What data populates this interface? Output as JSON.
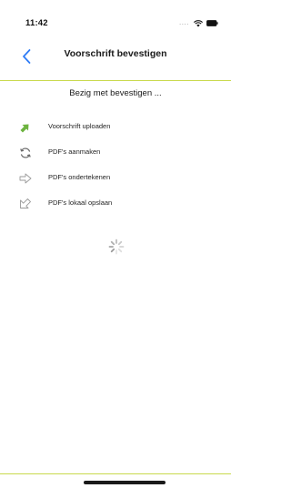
{
  "status_bar": {
    "time": "11:42",
    "signal": "....",
    "wifi_icon": "wifi-icon",
    "battery_icon": "battery-icon"
  },
  "nav": {
    "back_icon": "chevron-left-icon",
    "title": "Voorschrift bevestigen"
  },
  "status_message": "Bezig met bevestigen ...",
  "steps": [
    {
      "label": "Voorschrift uploaden",
      "icon": "arrow-up-right-icon",
      "state": "done"
    },
    {
      "label": "PDF's aanmaken",
      "icon": "refresh-icon",
      "state": "pending"
    },
    {
      "label": "PDF's ondertekenen",
      "icon": "arrow-right-outline-icon",
      "state": "pending"
    },
    {
      "label": "PDF's lokaal opslaan",
      "icon": "arrow-down-left-outline-icon",
      "state": "pending"
    }
  ],
  "spinner_icon": "loading-spinner-icon",
  "colors": {
    "accent": "#c9d94d",
    "done_green": "#6db33f",
    "link_blue": "#2f7cf6",
    "pending_gray": "#8a8a8a"
  }
}
